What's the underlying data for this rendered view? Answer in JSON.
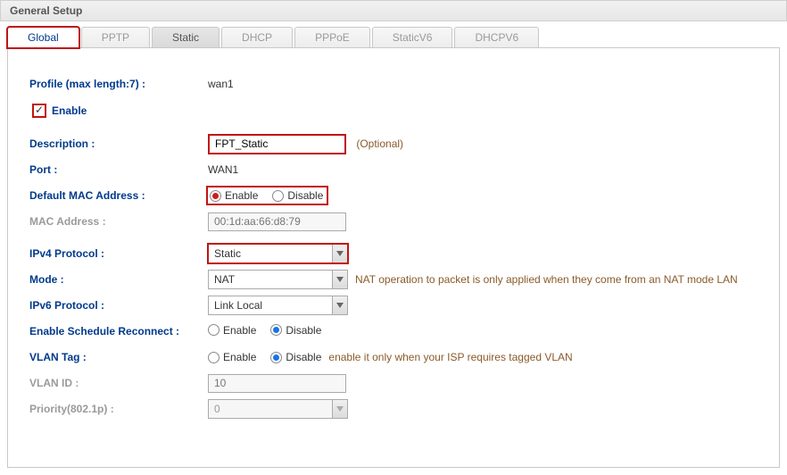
{
  "panel_title": "General Setup",
  "tabs": {
    "global": "Global",
    "pptp": "PPTP",
    "static": "Static",
    "dhcp": "DHCP",
    "pppoe": "PPPoE",
    "staticv6": "StaticV6",
    "dhcpv6": "DHCPV6"
  },
  "labels": {
    "profile": "Profile (max length:7) :",
    "enable": "Enable",
    "description": "Description :",
    "port": "Port :",
    "default_mac": "Default MAC Address :",
    "mac_addr": "MAC Address :",
    "ipv4": "IPv4 Protocol :",
    "mode": "Mode :",
    "ipv6": "IPv6 Protocol :",
    "sched": "Enable Schedule Reconnect :",
    "vlan_tag": "VLAN Tag :",
    "vlan_id": "VLAN ID :",
    "priority": "Priority(802.1p) :",
    "opt_enable": "Enable",
    "opt_disable": "Disable"
  },
  "values": {
    "profile": "wan1",
    "description": "FPT_Static",
    "description_hint": "(Optional)",
    "port": "WAN1",
    "mac_addr_placeholder": "00:1d:aa:66:d8:79",
    "ipv4": "Static",
    "mode": "NAT",
    "mode_hint": "NAT operation to packet is only applied when they come from an NAT mode LAN",
    "ipv6": "Link Local",
    "vlan_hint": "enable it only when your ISP requires tagged VLAN",
    "vlan_id_placeholder": "10",
    "priority": "0"
  }
}
